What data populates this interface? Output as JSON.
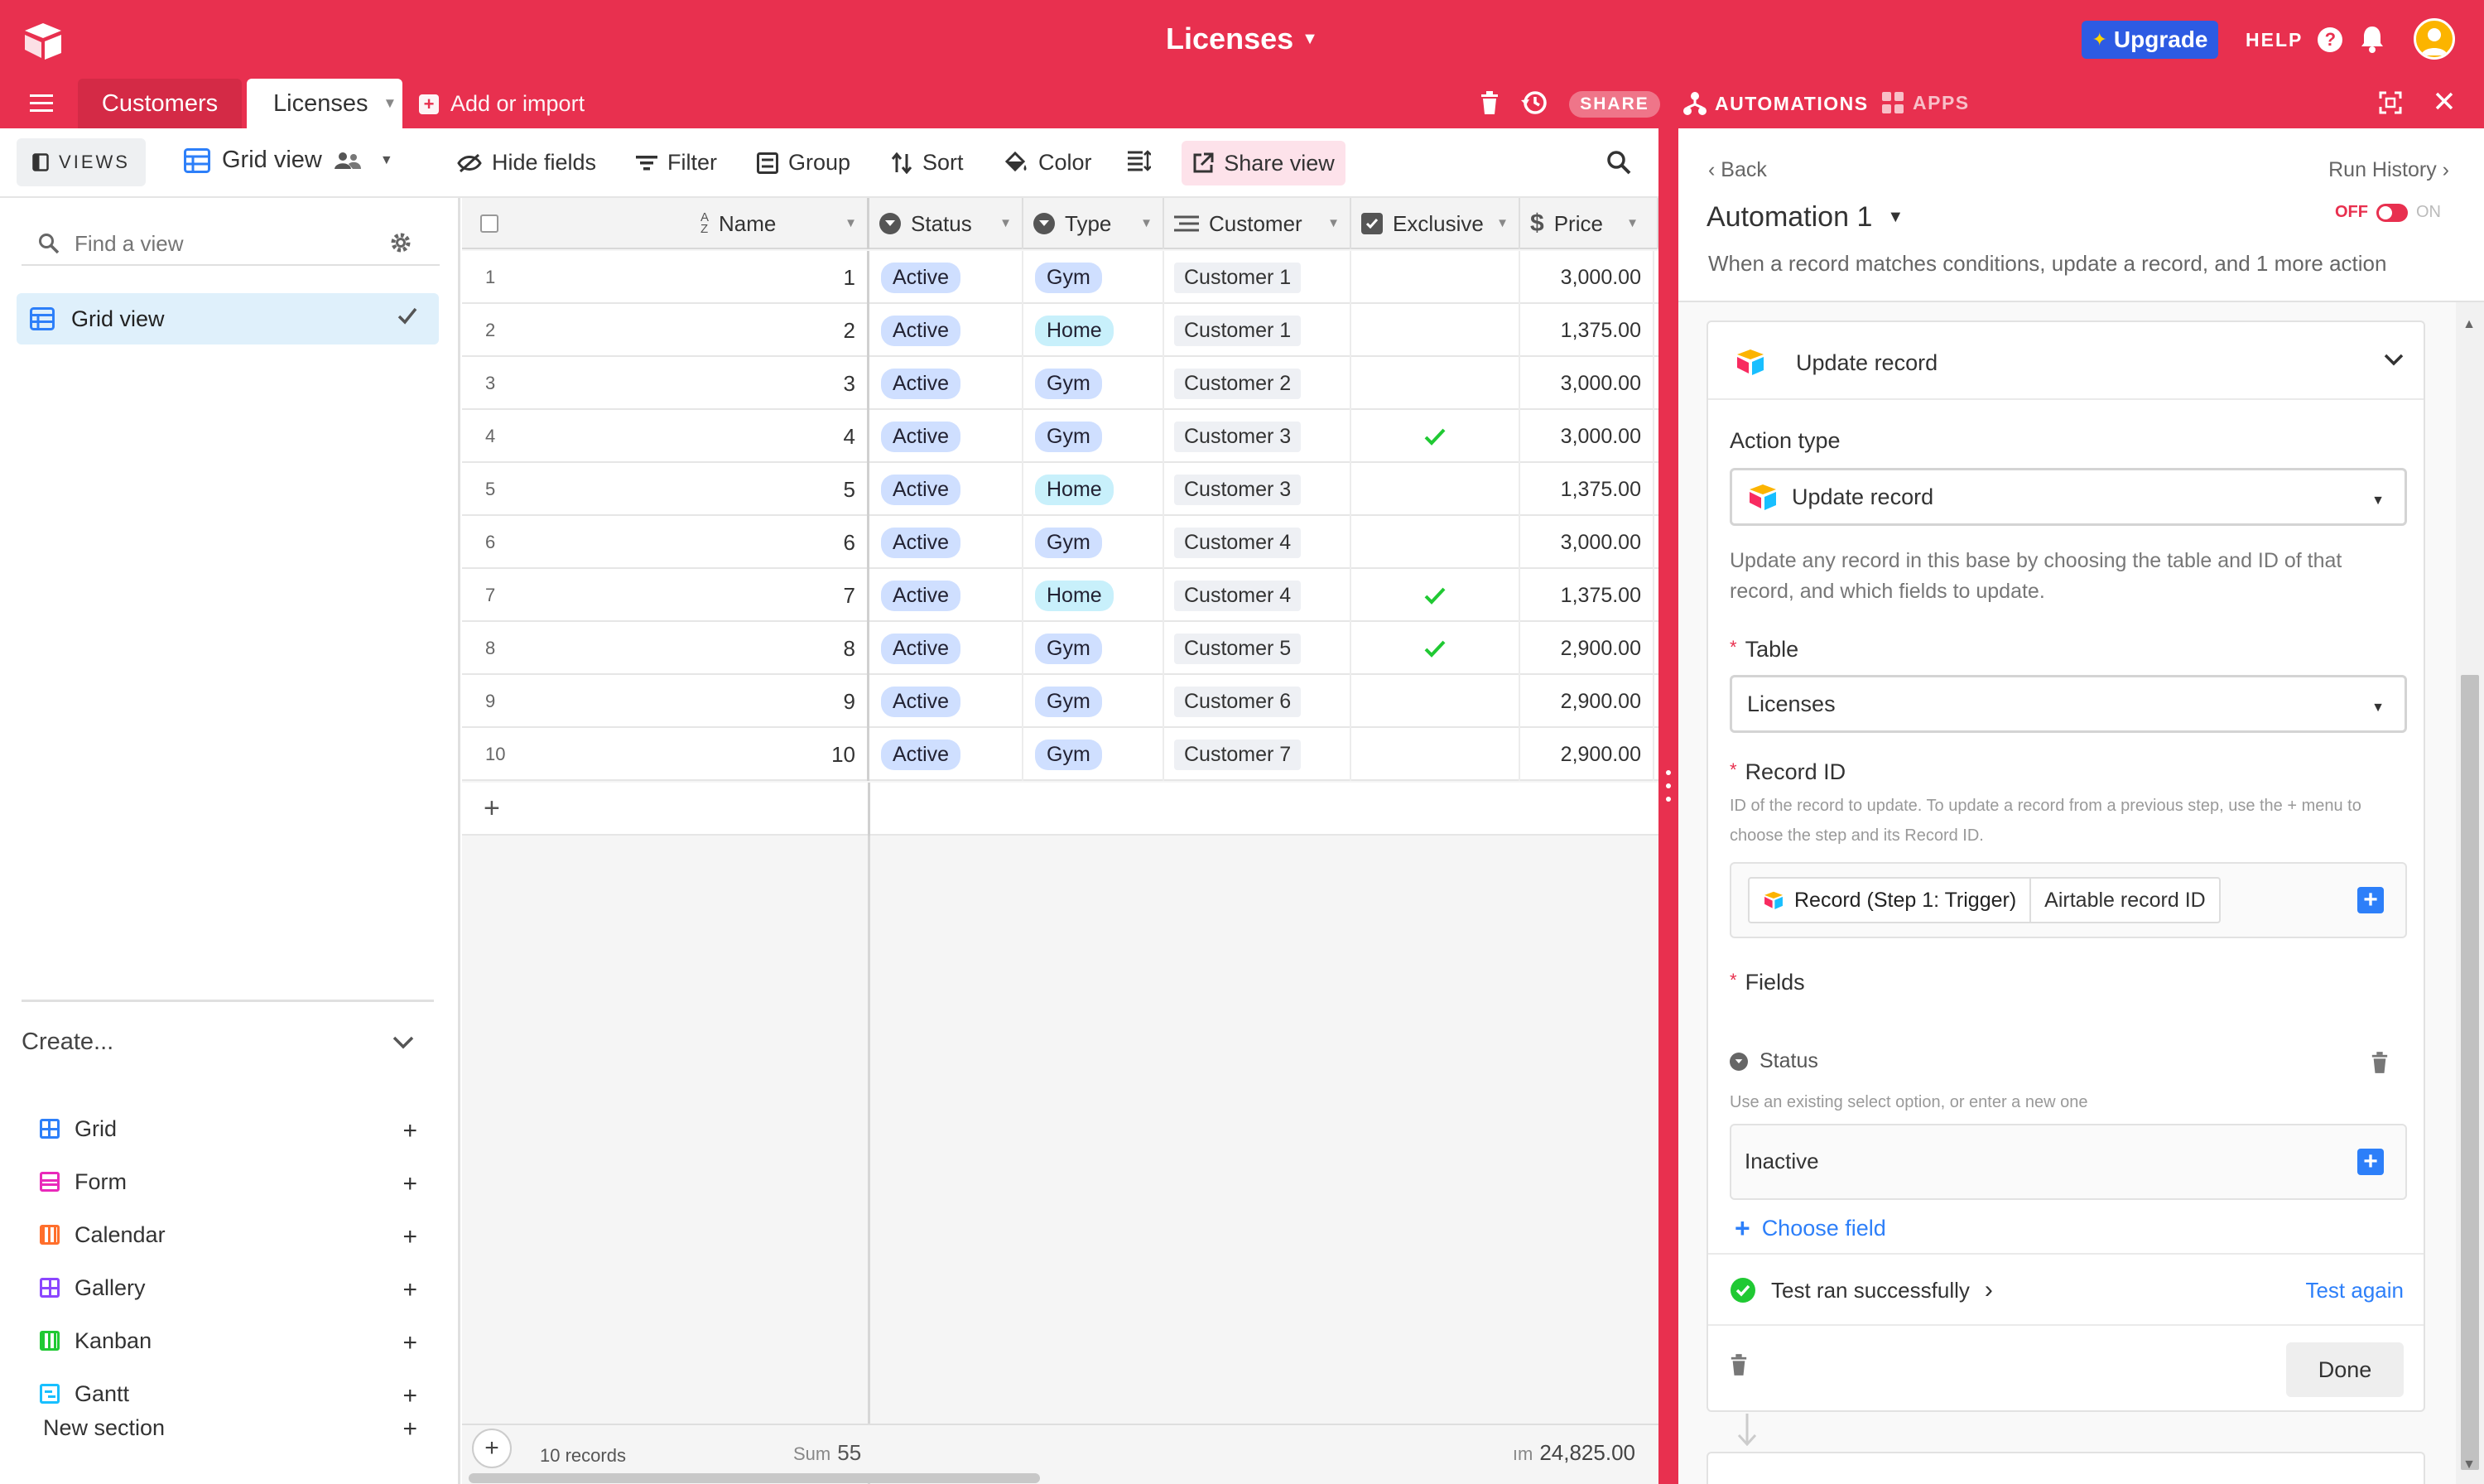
{
  "header": {
    "base_title": "Licenses",
    "upgrade_label": "Upgrade",
    "help_label": "HELP",
    "tabs": [
      {
        "label": "Customers"
      },
      {
        "label": "Licenses"
      }
    ],
    "add_import_label": "Add or import",
    "share_label": "SHARE",
    "automations_label": "AUTOMATIONS",
    "apps_label": "APPS",
    "brand_color": "#e8304f"
  },
  "toolbar": {
    "views_label": "VIEWS",
    "grid_view_label": "Grid view",
    "hide_fields": "Hide fields",
    "filter": "Filter",
    "group": "Group",
    "sort": "Sort",
    "color": "Color",
    "share_view": "Share view"
  },
  "sidebar": {
    "find_placeholder": "Find a view",
    "views": [
      {
        "label": "Grid view"
      }
    ],
    "create_title": "Create...",
    "create_items": [
      {
        "label": "Grid",
        "color": "#2d7ff9"
      },
      {
        "label": "Form",
        "color": "#e929ba"
      },
      {
        "label": "Calendar",
        "color": "#ff6f2c"
      },
      {
        "label": "Gallery",
        "color": "#8b46ff"
      },
      {
        "label": "Kanban",
        "color": "#20c933"
      },
      {
        "label": "Gantt",
        "color": "#18bfff"
      }
    ],
    "new_section_label": "New section"
  },
  "grid": {
    "columns": [
      "Name",
      "Status",
      "Type",
      "Customer",
      "Exclusive",
      "Price"
    ],
    "rows": [
      {
        "num": "1",
        "name": "1",
        "status": "Active",
        "type": "Gym",
        "customer": "Customer 1",
        "exclusive": false,
        "price": "3,000.00"
      },
      {
        "num": "2",
        "name": "2",
        "status": "Active",
        "type": "Home",
        "customer": "Customer 1",
        "exclusive": false,
        "price": "1,375.00"
      },
      {
        "num": "3",
        "name": "3",
        "status": "Active",
        "type": "Gym",
        "customer": "Customer 2",
        "exclusive": false,
        "price": "3,000.00"
      },
      {
        "num": "4",
        "name": "4",
        "status": "Active",
        "type": "Gym",
        "customer": "Customer 3",
        "exclusive": true,
        "price": "3,000.00"
      },
      {
        "num": "5",
        "name": "5",
        "status": "Active",
        "type": "Home",
        "customer": "Customer 3",
        "exclusive": false,
        "price": "1,375.00"
      },
      {
        "num": "6",
        "name": "6",
        "status": "Active",
        "type": "Gym",
        "customer": "Customer 4",
        "exclusive": false,
        "price": "3,000.00"
      },
      {
        "num": "7",
        "name": "7",
        "status": "Active",
        "type": "Home",
        "customer": "Customer 4",
        "exclusive": true,
        "price": "1,375.00"
      },
      {
        "num": "8",
        "name": "8",
        "status": "Active",
        "type": "Gym",
        "customer": "Customer 5",
        "exclusive": true,
        "price": "2,900.00"
      },
      {
        "num": "9",
        "name": "9",
        "status": "Active",
        "type": "Gym",
        "customer": "Customer 6",
        "exclusive": false,
        "price": "2,900.00"
      },
      {
        "num": "10",
        "name": "10",
        "status": "Active",
        "type": "Gym",
        "customer": "Customer 7",
        "exclusive": false,
        "price": "2,900.00"
      }
    ],
    "footer": {
      "records": "10 records",
      "sum_label": "Sum",
      "sum_value": "55",
      "price_label": "ım",
      "price_value": "24,825.00"
    }
  },
  "automation": {
    "back_label": "Back",
    "run_history_label": "Run History",
    "name": "Automation 1",
    "toggle_off": "OFF",
    "toggle_on": "ON",
    "description": "When a record matches conditions, update a record, and 1 more action",
    "action_card": {
      "title": "Update record",
      "action_type_label": "Action type",
      "action_type_value": "Update record",
      "help": "Update any record in this base by choosing the table and ID of that record, and which fields to update.",
      "table_label": "Table",
      "table_value": "Licenses",
      "record_id_label": "Record ID",
      "record_id_help": "ID of the record to update. To update a record from a previous step, use the + menu to choose the step and its Record ID.",
      "token_source": "Record (Step 1: Trigger)",
      "token_field": "Airtable record ID",
      "fields_label": "Fields",
      "status_field": "Status",
      "status_help": "Use an existing select option, or enter a new one",
      "status_value": "Inactive",
      "choose_field": "Choose field",
      "test_status": "Test ran successfully",
      "test_again": "Test again",
      "done_label": "Done"
    }
  }
}
